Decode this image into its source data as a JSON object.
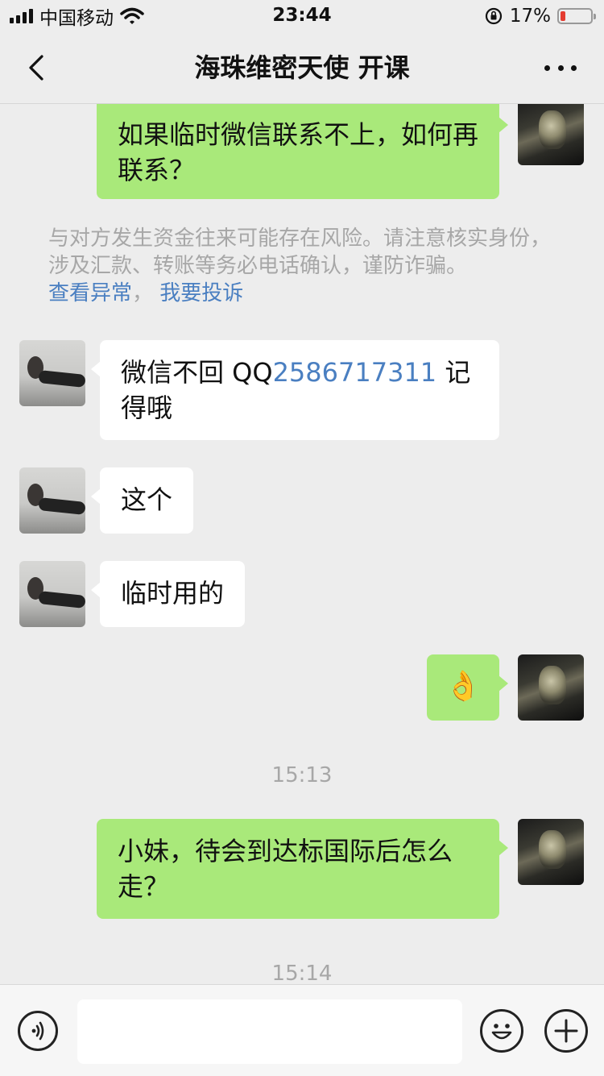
{
  "status_bar": {
    "carrier": "中国移动",
    "time": "23:44",
    "battery_percent_label": "17%",
    "battery_level": 0.17,
    "battery_color": "#e43b30"
  },
  "nav": {
    "title": "海珠维密天使 开课",
    "back_icon": "chevron-left-icon",
    "more_icon": "more-dots-icon"
  },
  "chat": {
    "m1": {
      "side": "right",
      "text": "如果临时微信联系不上，如何再联系？"
    },
    "warning": {
      "text": "与对方发生资金往来可能存在风险。请注意核实身份，涉及汇款、转账等务必电话确认，谨防诈骗。",
      "link1": "查看异常",
      "sep": "，",
      "link2": "我要投诉"
    },
    "m2": {
      "side": "left",
      "prefix": "微信不回  QQ",
      "qq": "2586717311",
      "suffix": " 记得哦"
    },
    "m3": {
      "side": "left",
      "text": "这个"
    },
    "m4": {
      "side": "left",
      "text": "临时用的"
    },
    "m5": {
      "side": "right",
      "text": "👌"
    },
    "time1": "15:13",
    "m6": {
      "side": "right",
      "text": "小妹，待会到达标国际后怎么走？"
    },
    "time2": "15:14"
  },
  "input_bar": {
    "voice_icon": "voice-icon",
    "emoji_icon": "emoji-icon",
    "plus_icon": "plus-icon",
    "value": ""
  },
  "colors": {
    "background": "#ededed",
    "bubble_sent": "#a9e97a",
    "bubble_received": "#ffffff",
    "link": "#4a7fc1",
    "muted_text": "#a7a7a7"
  }
}
